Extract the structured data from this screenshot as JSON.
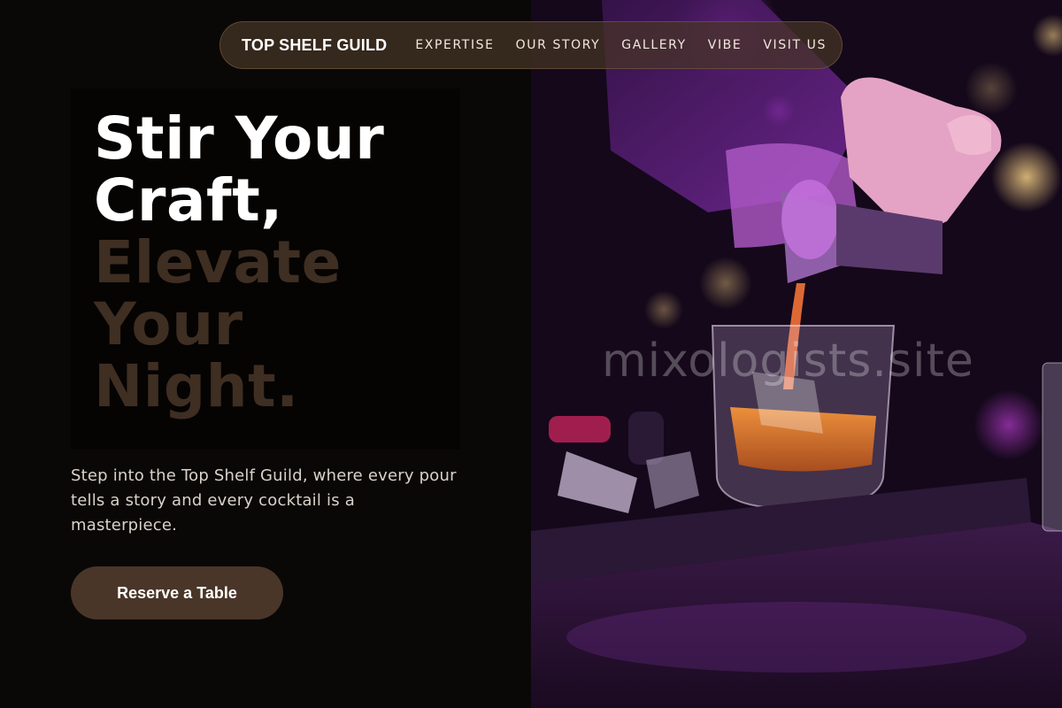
{
  "nav": {
    "brand": "TOP SHELF GUILD",
    "links": [
      {
        "label": "EXPERTISE"
      },
      {
        "label": "OUR STORY"
      },
      {
        "label": "GALLERY"
      },
      {
        "label": "VIBE"
      },
      {
        "label": "VISIT US"
      }
    ]
  },
  "hero": {
    "headline_light": [
      "Stir Your",
      "Craft,"
    ],
    "headline_dark": [
      "Elevate",
      "Your",
      "Night."
    ],
    "subtext": "Step into the Top Shelf Guild, where every pour tells a story and every cocktail is a masterpiece.",
    "cta_label": "Reserve a Table",
    "watermark": "mixologists.site"
  },
  "colors": {
    "background": "#0a0807",
    "headline_accent": "#3f2e22",
    "button": "#4a3628",
    "nav_pill": "#46342a"
  }
}
